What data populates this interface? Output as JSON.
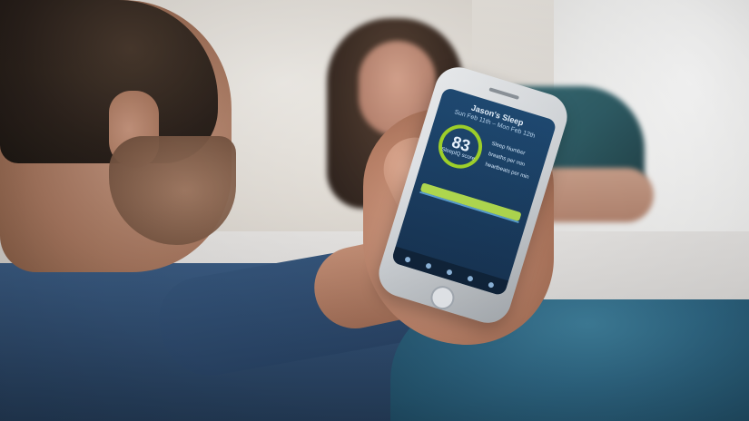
{
  "scene": {
    "alt": "",
    "colors": {
      "blanket": "#2e6683",
      "shirt": "#2e4a6c",
      "app_background": "#1b3f63",
      "app_accent": "#9fd12a"
    }
  },
  "phone_app": {
    "title": "Jason's Sleep",
    "subtitle": "Sun Feb 11th – Mon Feb 12th",
    "score_value": "83",
    "score_label": "SleepIQ score",
    "metrics": [
      {
        "label": "Sleep Number"
      },
      {
        "label": "breaths per min"
      },
      {
        "label": "heartbeats per min"
      }
    ]
  }
}
